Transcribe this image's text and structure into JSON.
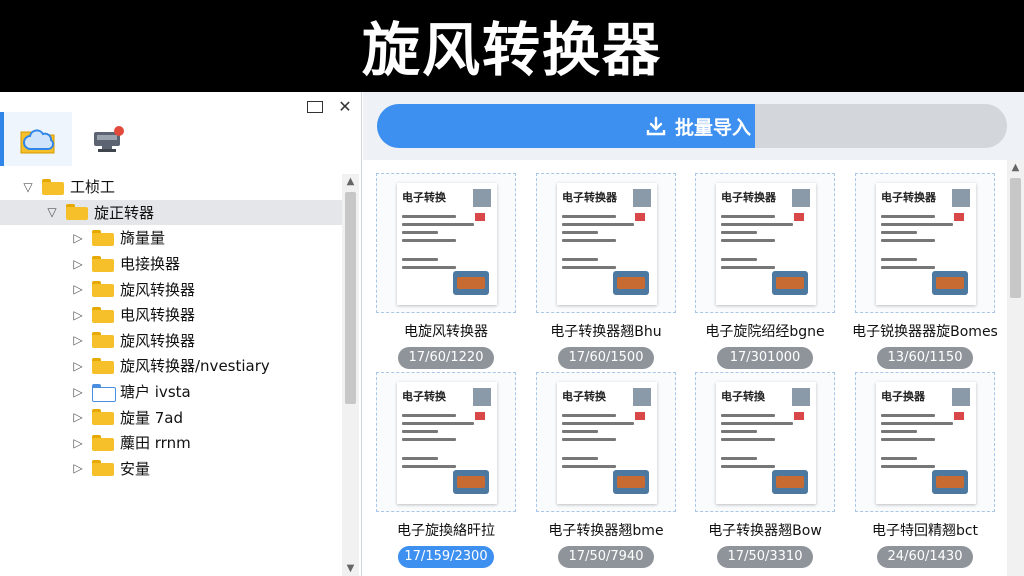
{
  "header": {
    "title": "旋风转换器"
  },
  "window": {
    "restore_icon": "restore-icon",
    "close_label": "✕"
  },
  "tabs": [
    {
      "name": "folder-cloud-icon",
      "active": true
    },
    {
      "name": "device-icon",
      "active": false
    }
  ],
  "tree": [
    {
      "label": "工桢工",
      "level": 0,
      "arrow": "▽",
      "folder": "yellow"
    },
    {
      "label": "旋正转器",
      "level": 1,
      "arrow": "▽",
      "folder": "yellow",
      "selected": true
    },
    {
      "label": "旖量量",
      "level": 2,
      "arrow": "▷",
      "folder": "yellow"
    },
    {
      "label": "电接换器",
      "level": 2,
      "arrow": "▷",
      "folder": "yellow"
    },
    {
      "label": "旋风转换器",
      "level": 2,
      "arrow": "▷",
      "folder": "yellow"
    },
    {
      "label": "电风转换器",
      "level": 2,
      "arrow": "▷",
      "folder": "yellow"
    },
    {
      "label": "旋风转换器",
      "level": 2,
      "arrow": "▷",
      "folder": "yellow"
    },
    {
      "label": "旋风转换器/nvestiary",
      "level": 2,
      "arrow": "▷",
      "folder": "yellow"
    },
    {
      "label": "瑭户 ivsta",
      "level": 2,
      "arrow": "▷",
      "folder": "blue"
    },
    {
      "label": "旋量 7ad",
      "level": 2,
      "arrow": "▷",
      "folder": "yellow"
    },
    {
      "label": "蘪田 rrnm",
      "level": 2,
      "arrow": "▷",
      "folder": "yellow"
    },
    {
      "label": "安量",
      "level": 2,
      "arrow": "▷",
      "folder": "yellow"
    }
  ],
  "toolbar": {
    "import_label": "批量导入"
  },
  "files": [
    {
      "doc_title": "电子转换",
      "name": "电旋风转换器",
      "size": "17/60/1220",
      "highlight": false
    },
    {
      "doc_title": "电子转换器",
      "name": "电子转换器翘Bhu",
      "size": "17/60/1500",
      "highlight": false
    },
    {
      "doc_title": "电子转换器",
      "name": "电子旋院绍经bgne",
      "size": "17/301000",
      "highlight": false
    },
    {
      "doc_title": "电子转换器",
      "name": "电子锐换器器旋Bomes",
      "size": "13/60/1150",
      "highlight": false
    },
    {
      "doc_title": "电子转换",
      "name": "电子旋換絡旰拉",
      "size": "17/159/2300",
      "highlight": true
    },
    {
      "doc_title": "电子转换",
      "name": "电子转换器翘bme",
      "size": "17/50/7940",
      "highlight": false
    },
    {
      "doc_title": "电子转換",
      "name": "电子转换器翘Bow",
      "size": "17/50/3310",
      "highlight": false
    },
    {
      "doc_title": "电子换器",
      "name": "电子特回精翘bct",
      "size": "24/60/1430",
      "highlight": false
    }
  ]
}
